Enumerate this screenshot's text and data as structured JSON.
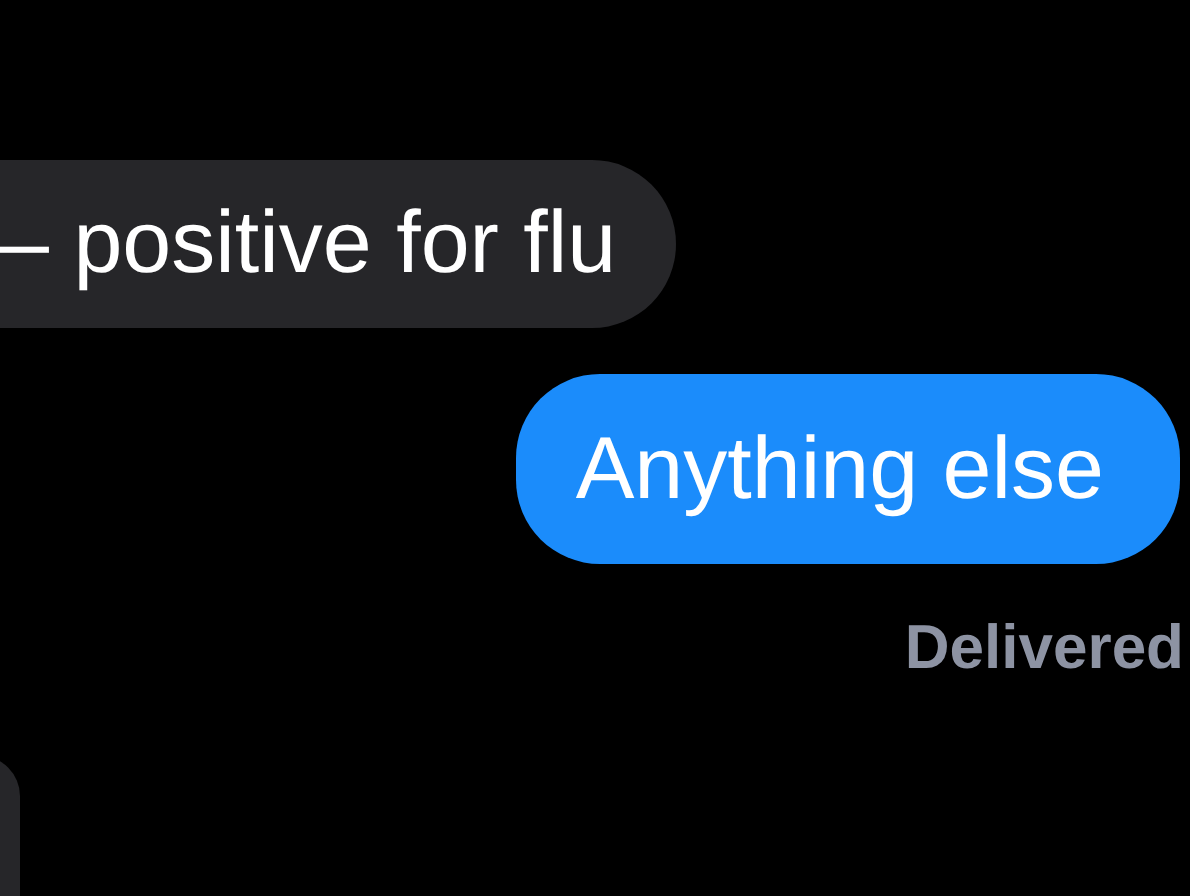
{
  "messages": [
    {
      "kind": "received",
      "text": "– positive for flu"
    },
    {
      "kind": "sent",
      "text": "Anything else"
    },
    {
      "kind": "received_partial"
    }
  ],
  "status": "Delivered"
}
